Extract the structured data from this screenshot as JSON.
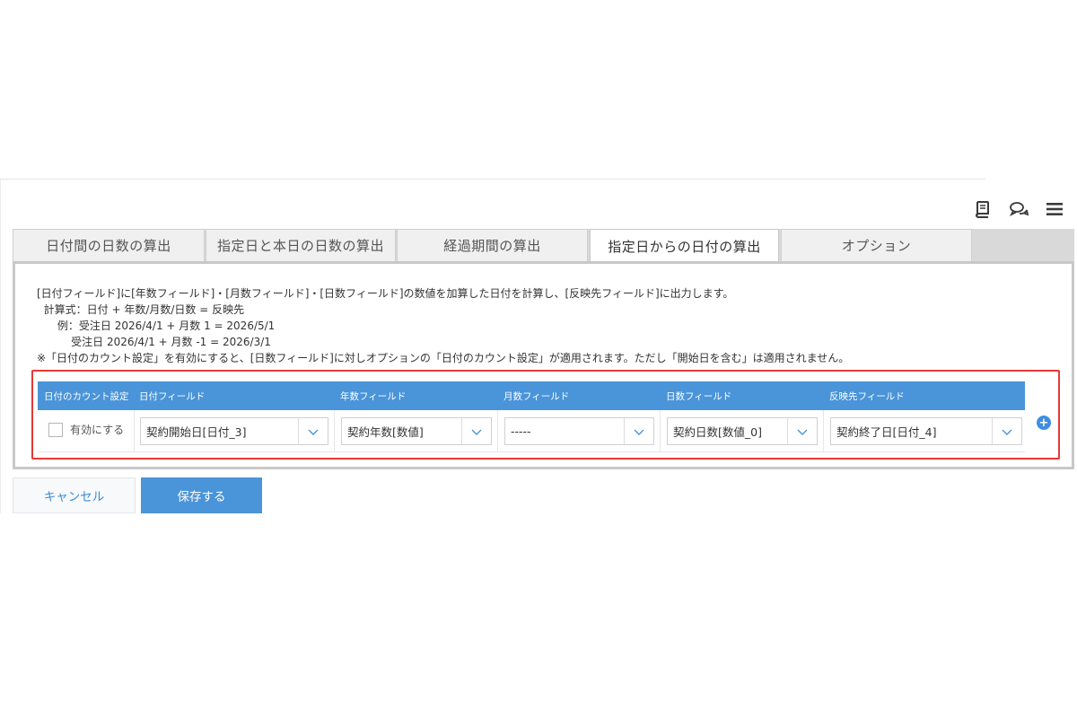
{
  "header": {
    "icons": [
      "book-icon",
      "chat-icon",
      "menu-icon"
    ]
  },
  "tabs": [
    {
      "label": "日付間の日数の算出",
      "active": false
    },
    {
      "label": "指定日と本日の日数の算出",
      "active": false
    },
    {
      "label": "経過期間の算出",
      "active": false
    },
    {
      "label": "指定日からの日付の算出",
      "active": true
    },
    {
      "label": "オプション",
      "active": false
    }
  ],
  "description": {
    "line1": "[日付フィールド]に[年数フィールド]・[月数フィールド]・[日数フィールド]の数値を加算した日付を計算し、[反映先フィールド]に出力します。",
    "line2": "  計算式：日付 + 年数/月数/日数 = 反映先",
    "line3": "      例：受注日 2026/4/1 + 月数 1 = 2026/5/1",
    "line4": "          受注日 2026/4/1 + 月数 -1 = 2026/3/1",
    "line5": "※「日付のカウント設定」を有効にすると、[日数フィールド]に対しオプションの「日付のカウント設定」が適用されます。ただし「開始日を含む」は適用されません。"
  },
  "table": {
    "headers": {
      "count_setting": "日付のカウント設定",
      "date_field": "日付フィールド",
      "years_field": "年数フィールド",
      "months_field": "月数フィールド",
      "days_field": "日数フィールド",
      "target_field": "反映先フィールド"
    },
    "row": {
      "enable_label": "有効にする",
      "enable_checked": false,
      "date_field": "契約開始日[日付_3]",
      "years_field": "契約年数[数値]",
      "months_field": "-----",
      "days_field": "契約日数[数値_0]",
      "target_field": "契約終了日[日付_4]"
    },
    "add_label": "+"
  },
  "buttons": {
    "cancel": "キャンセル",
    "save": "保存する"
  },
  "colors": {
    "accent": "#4a94d9",
    "highlight": "#e53935"
  }
}
